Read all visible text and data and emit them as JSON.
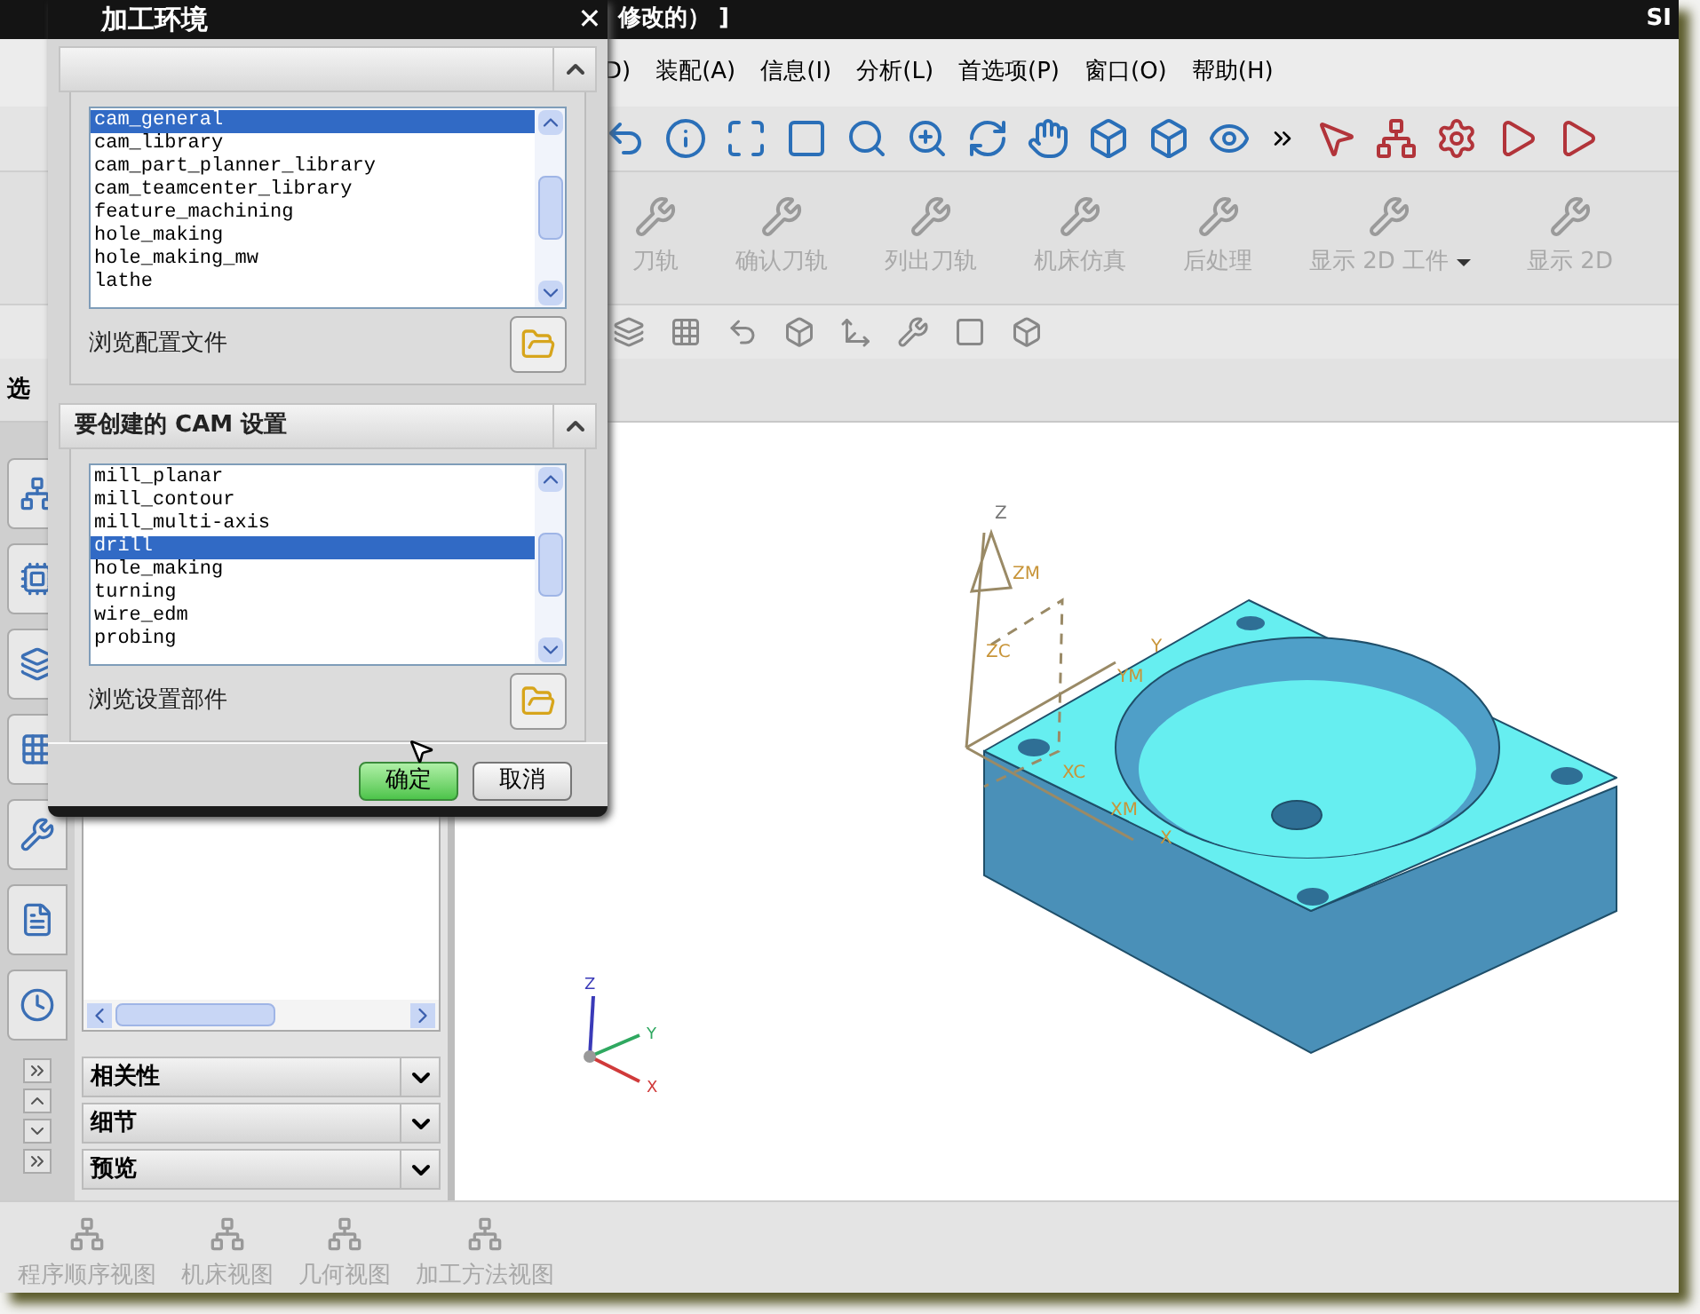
{
  "title_bar": {
    "text": "修改的） ]",
    "right_text": "SI"
  },
  "menu": [
    {
      "label": "D)"
    },
    {
      "label": "装配(A)"
    },
    {
      "label": "信息(I)"
    },
    {
      "label": "分析(L)"
    },
    {
      "label": "首选项(P)"
    },
    {
      "label": "窗口(O)"
    },
    {
      "label": "帮助(H)"
    }
  ],
  "commands": [
    {
      "label": "刀轨",
      "disabled": true,
      "dropdown": false
    },
    {
      "label": "确认刀轨",
      "disabled": true,
      "dropdown": false
    },
    {
      "label": "列出刀轨",
      "disabled": true,
      "dropdown": false
    },
    {
      "label": "机床仿真",
      "disabled": true,
      "dropdown": false
    },
    {
      "label": "后处理",
      "disabled": true,
      "dropdown": false
    },
    {
      "label": "显示 2D 工件",
      "disabled": true,
      "dropdown": true
    },
    {
      "label": "显示 2D",
      "disabled": true,
      "dropdown": false
    }
  ],
  "selection_bar": {
    "label": "选"
  },
  "left_panel": {
    "sections": [
      {
        "label": "相关性",
        "expanded": false
      },
      {
        "label": "细节",
        "expanded": false
      },
      {
        "label": "预览",
        "expanded": false
      }
    ]
  },
  "bottom_views": [
    {
      "label": "程序顺序视图",
      "disabled": true
    },
    {
      "label": "机床视图",
      "disabled": true
    },
    {
      "label": "几何视图",
      "disabled": true
    },
    {
      "label": "加工方法视图",
      "disabled": true
    }
  ],
  "viewport": {
    "triad_labels": [
      "Z",
      "Y",
      "X"
    ],
    "csys_labels": [
      "Z",
      "ZM",
      "ZC",
      "Y",
      "YM",
      "XC",
      "XM",
      "X"
    ]
  },
  "dialog": {
    "title": "加工环境",
    "close": "✕",
    "sections": [
      {
        "expanded": true,
        "items": [
          {
            "label": "cam_general",
            "selected": true
          },
          {
            "label": "cam_library",
            "selected": false
          },
          {
            "label": "cam_part_planner_library",
            "selected": false
          },
          {
            "label": "cam_teamcenter_library",
            "selected": false
          },
          {
            "label": "feature_machining",
            "selected": false
          },
          {
            "label": "hole_making",
            "selected": false
          },
          {
            "label": "hole_making_mw",
            "selected": false
          },
          {
            "label": "lathe",
            "selected": false
          }
        ],
        "browse_label": "浏览配置文件"
      },
      {
        "title": "要创建的 CAM 设置",
        "expanded": true,
        "items": [
          {
            "label": "mill_planar",
            "selected": false
          },
          {
            "label": "mill_contour",
            "selected": false
          },
          {
            "label": "mill_multi-axis",
            "selected": false
          },
          {
            "label": "drill",
            "selected": true
          },
          {
            "label": "hole_making",
            "selected": false
          },
          {
            "label": "turning",
            "selected": false
          },
          {
            "label": "wire_edm",
            "selected": false
          },
          {
            "label": "probing",
            "selected": false
          }
        ],
        "browse_label": "浏览设置部件"
      }
    ],
    "buttons": [
      {
        "label": "确定",
        "primary": true
      },
      {
        "label": "取消",
        "primary": false
      }
    ]
  }
}
